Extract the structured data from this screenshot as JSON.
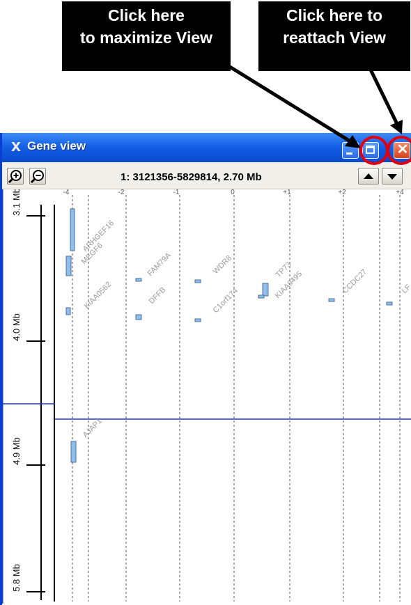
{
  "callouts": {
    "maximize": {
      "line1": "Click here",
      "line2": "to maximize View"
    },
    "reattach": {
      "line1": "Click here to",
      "line2": "reattach View"
    }
  },
  "window": {
    "title": "Gene view",
    "app_icon": "X",
    "buttons": [
      "minimize-icon",
      "maximize-icon",
      "close-icon"
    ]
  },
  "toolbar": {
    "zoom_in_icon": "zoom-in-icon",
    "zoom_out_icon": "zoom-out-icon",
    "region": "1: 3121356-5829814, 2.70 Mb",
    "scroll_up_icon": "triangle-up-icon",
    "scroll_down_icon": "triangle-down-icon"
  },
  "axis": {
    "top_ticks": [
      {
        "label": "-4",
        "value": -4
      },
      {
        "label": "-2",
        "value": -2
      },
      {
        "label": "-1",
        "value": -1
      },
      {
        "label": "0",
        "value": 0
      },
      {
        "label": "+1",
        "value": 1
      },
      {
        "label": "+2",
        "value": 2
      },
      {
        "label": "+4",
        "value": 4
      }
    ],
    "mb_ticks": [
      {
        "label": "3.1 Mb",
        "mb": 3.1
      },
      {
        "label": "4.0 Mb",
        "mb": 4.0
      },
      {
        "label": "4.9 Mb",
        "mb": 4.9
      },
      {
        "label": "5.8 Mb",
        "mb": 5.8
      }
    ]
  },
  "genes": [
    {
      "name": "ARHGEF16"
    },
    {
      "name": "MEGF6"
    },
    {
      "name": "KIAA0562"
    },
    {
      "name": "FAM79A"
    },
    {
      "name": "DFFB"
    },
    {
      "name": "WDR8"
    },
    {
      "name": "C1orf174"
    },
    {
      "name": "TP73"
    },
    {
      "name": "KIAA0495"
    },
    {
      "name": "CCDC27"
    },
    {
      "name": "LF"
    },
    {
      "name": "AJAP1"
    }
  ],
  "colors": {
    "titlebar": "#0c52d8",
    "gene_fill": "#8fbfe8",
    "gene_stroke": "#4a6fa0",
    "selection_line": "#2233cc",
    "highlight_ring": "#e00010"
  }
}
